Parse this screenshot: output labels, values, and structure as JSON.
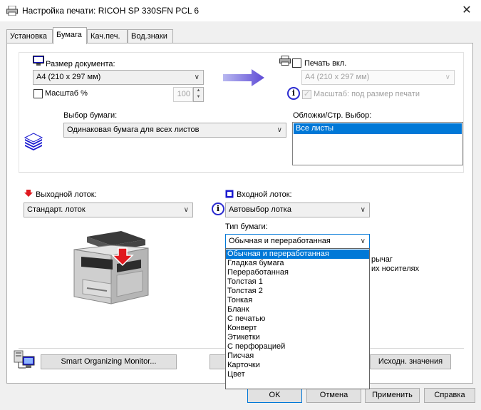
{
  "window": {
    "title": "Настройка печати: RICOH SP 330SFN PCL 6",
    "close_glyph": "✕"
  },
  "tabs": [
    {
      "label": "Установка"
    },
    {
      "label": "Бумага"
    },
    {
      "label": "Кач.печ."
    },
    {
      "label": "Вод.знаки"
    }
  ],
  "paper": {
    "doc_size_label": "Размер документа:",
    "doc_size_value": "A4 (210 x 297 мм)",
    "scale_label": "Масштаб %",
    "scale_value": "100",
    "print_on_label": "Печать вкл.",
    "print_on_value": "A4 (210 x 297 мм)",
    "fit_label": "Масштаб: под размер печати",
    "paper_select_label": "Выбор бумаги:",
    "paper_select_value": "Одинаковая бумага для всех листов",
    "covers_label": "Обложки/Стр. Выбор:",
    "covers_items": [
      "Все листы"
    ]
  },
  "trays": {
    "output_label": "Выходной лоток:",
    "output_value": "Стандарт. лоток",
    "input_label": "Входной лоток:",
    "input_value": "Автовыбор лотка",
    "paper_type_label": "Тип бумаги:",
    "paper_type_value": "Обычная и переработанная",
    "paper_type_options": [
      "Обычная и переработанная",
      "Гладкая бумага",
      "Переработанная",
      "Толстая 1",
      "Толстая 2",
      "Тонкая",
      "Бланк",
      "С печатью",
      "Конверт",
      "Этикетки",
      "С перфорацией",
      "Писчая",
      "Карточки",
      "Цвет"
    ],
    "hidden_text_1": "рычаг",
    "hidden_text_2": "их носителях"
  },
  "bottom": {
    "smart_monitor": "Smart Organizing Monitor...",
    "defaults": "Исходн. значения"
  },
  "footer": {
    "ok": "OK",
    "cancel": "Отмена",
    "apply": "Применить",
    "help": "Справка"
  },
  "colors": {
    "accent": "#0078d7",
    "output_arrow": "#e0191f",
    "input_tray_icon": "#1b1bd0",
    "big_arrow": "#5f4bd6"
  }
}
